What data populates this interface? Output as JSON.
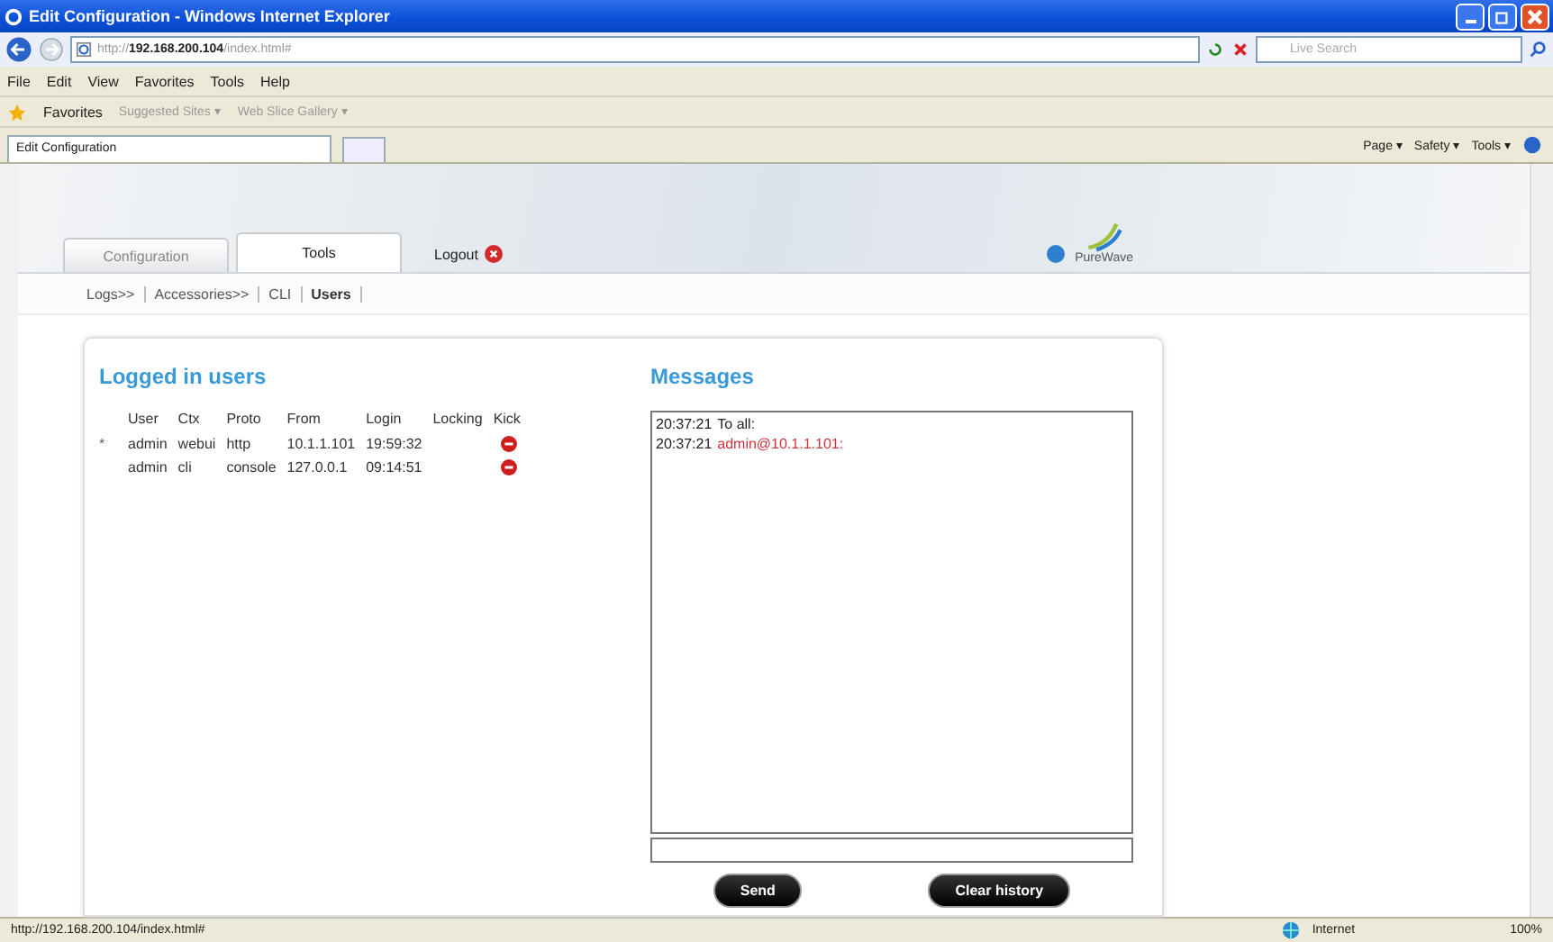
{
  "window": {
    "title": "Edit Configuration - Windows Internet Explorer"
  },
  "address_bar": {
    "url_prefix": "http://",
    "url_host": "192.168.200.104",
    "url_path": "/index.html#",
    "search_placeholder": "Live Search"
  },
  "menu": [
    "File",
    "Edit",
    "View",
    "Favorites",
    "Tools",
    "Help"
  ],
  "favorites_bar": {
    "label": "Favorites",
    "links": [
      {
        "label": "Suggested Sites ▾"
      },
      {
        "label": "Web Slice Gallery ▾"
      }
    ]
  },
  "browser_tab": {
    "title": "Edit Configuration"
  },
  "command_bar": [
    "Page ▾",
    "Safety ▾",
    "Tools ▾"
  ],
  "page": {
    "tabs": [
      {
        "label": "Configuration",
        "selected": false
      },
      {
        "label": "Tools",
        "selected": true
      }
    ],
    "logout": "Logout",
    "logo": "PureWave",
    "subnav": [
      {
        "label": "Logs>>",
        "selected": false
      },
      {
        "label": "Accessories>>",
        "selected": false
      },
      {
        "label": "CLI",
        "selected": false
      },
      {
        "label": "Users",
        "selected": true
      }
    ],
    "users": {
      "title": "Logged in users",
      "columns": [
        "User",
        "Ctx",
        "Proto",
        "From",
        "Login",
        "Locking",
        "Kick"
      ],
      "rows": [
        {
          "marker": "*",
          "cells": [
            "admin",
            "webui",
            "http",
            "10.1.1.101",
            "19:59:32"
          ]
        },
        {
          "cells": [
            "admin",
            "cli",
            "console",
            "127.0.0.1",
            "09:14:51"
          ]
        }
      ]
    },
    "messages": {
      "title": "Messages",
      "lines": [
        {
          "time": "20:37:21",
          "text": "To all:",
          "highlight": false
        },
        {
          "time": "20:37:21",
          "text": "admin@10.1.1.101:",
          "highlight": true
        }
      ]
    },
    "buttons": [
      "Send",
      "Clear history"
    ]
  },
  "status_bar": {
    "url": "http://192.168.200.104/index.html#",
    "zone": "Internet",
    "zoom": "100%"
  }
}
